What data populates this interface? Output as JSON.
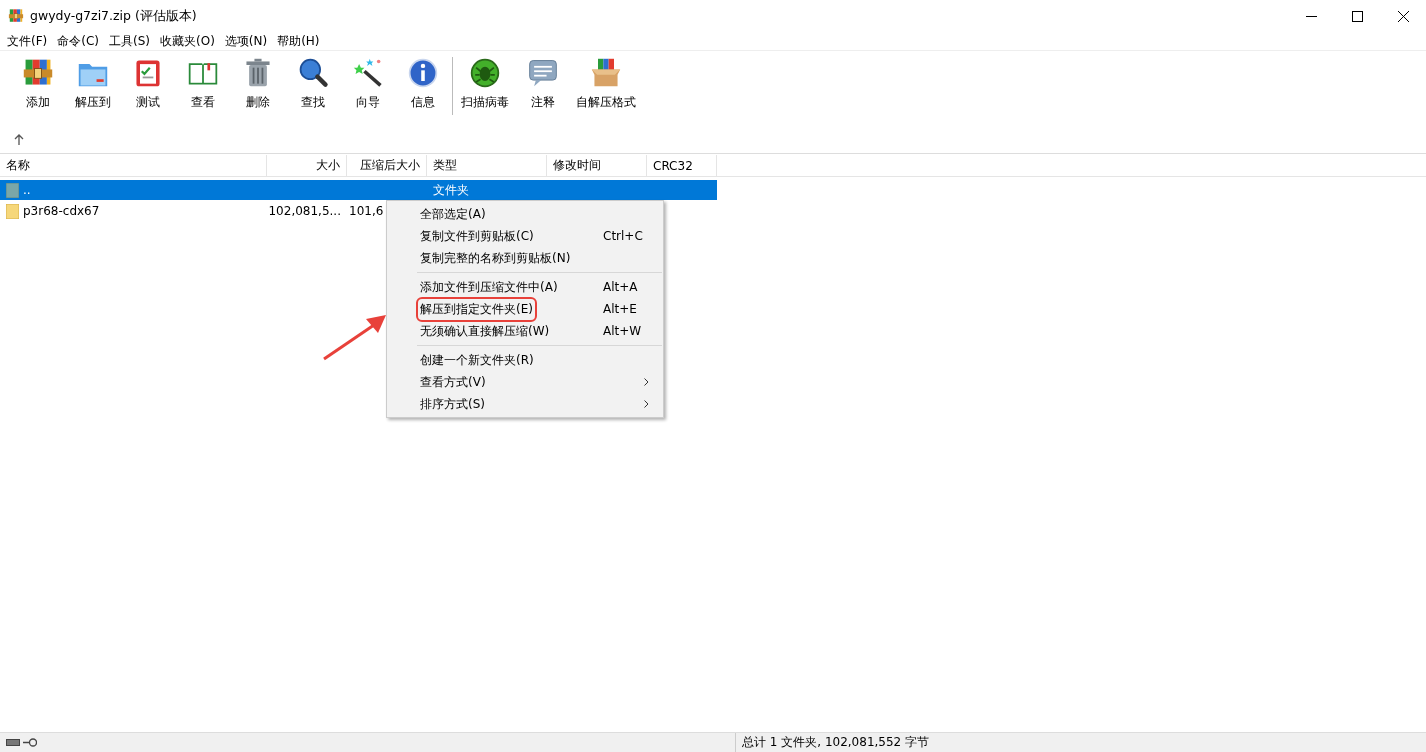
{
  "window": {
    "title": "gwydy-g7zi7.zip (评估版本)"
  },
  "menu_bar": [
    "文件(F)",
    "命令(C)",
    "工具(S)",
    "收藏夹(O)",
    "选项(N)",
    "帮助(H)"
  ],
  "toolbar": [
    {
      "kind": "add",
      "label": "添加"
    },
    {
      "kind": "extract",
      "label": "解压到"
    },
    {
      "kind": "test",
      "label": "测试"
    },
    {
      "kind": "view",
      "label": "查看"
    },
    {
      "kind": "delete",
      "label": "删除"
    },
    {
      "kind": "find",
      "label": "查找"
    },
    {
      "kind": "wizard",
      "label": "向导"
    },
    {
      "kind": "info",
      "label": "信息"
    },
    {
      "kind": "virus",
      "label": "扫描病毒"
    },
    {
      "kind": "comment",
      "label": "注释"
    },
    {
      "kind": "sfx",
      "label": "自解压格式"
    }
  ],
  "table": {
    "columns": [
      "名称",
      "大小",
      "压缩后大小",
      "类型",
      "修改时间",
      "CRC32"
    ],
    "rows": [
      {
        "kind": "parent",
        "selected": true,
        "cells": [
          "..",
          "",
          "",
          "文件夹",
          "",
          ""
        ]
      },
      {
        "kind": "folder",
        "selected": false,
        "cells": [
          "p3r68-cdx67",
          "102,081,5...",
          "101,6",
          "",
          "",
          ""
        ]
      }
    ]
  },
  "context_menu": {
    "groups": [
      {
        "items": [
          {
            "label": "全部选定(A)",
            "submenu": false,
            "highlighted": false
          },
          {
            "label": "复制文件到剪贴板(C)",
            "shortcut": "Ctrl+C",
            "submenu": false,
            "highlighted": false
          },
          {
            "label": "复制完整的名称到剪贴板(N)",
            "submenu": false,
            "highlighted": false
          }
        ]
      },
      {
        "items": [
          {
            "label": "添加文件到压缩文件中(A)",
            "shortcut": "Alt+A",
            "submenu": false,
            "highlighted": false
          },
          {
            "label": "解压到指定文件夹(E)",
            "shortcut": "Alt+E",
            "submenu": false,
            "highlighted": true
          },
          {
            "label": "无须确认直接解压缩(W)",
            "shortcut": "Alt+W",
            "submenu": false,
            "highlighted": false
          }
        ]
      },
      {
        "items": [
          {
            "label": "创建一个新文件夹(R)",
            "submenu": false,
            "highlighted": false
          },
          {
            "label": "查看方式(V)",
            "submenu": true,
            "highlighted": false
          },
          {
            "label": "排序方式(S)",
            "submenu": true,
            "highlighted": false
          }
        ]
      }
    ]
  },
  "status_bar": {
    "text": "总计 1 文件夹, 102,081,552 字节"
  }
}
